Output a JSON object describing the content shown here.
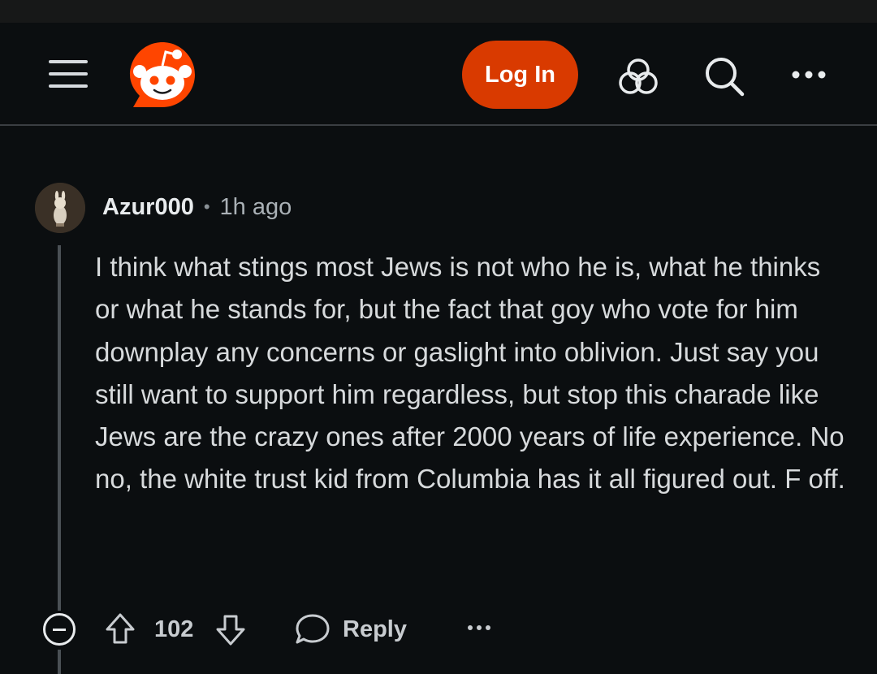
{
  "header": {
    "menu_icon": "hamburger-menu-icon",
    "logo_icon": "reddit-snoo-logo",
    "login_label": "Log In",
    "actions": [
      "community-icon",
      "search-icon",
      "more-options-icon"
    ],
    "brand_color": "#d93a00"
  },
  "comment": {
    "author": "Azur000",
    "separator": "•",
    "time": "1h ago",
    "body": "I think what stings most Jews is not who he is, what he thinks or what he stands for, but the fact that goy who vote for him downplay any concerns or gaslight into oblivion. Just say you still want to support him regardless, but stop this charade like Jews are the crazy ones after 2000 years of life experience. No no, the white trust kid from Columbia has it all figured out. F off.",
    "score": "102",
    "reply_label": "Reply"
  }
}
